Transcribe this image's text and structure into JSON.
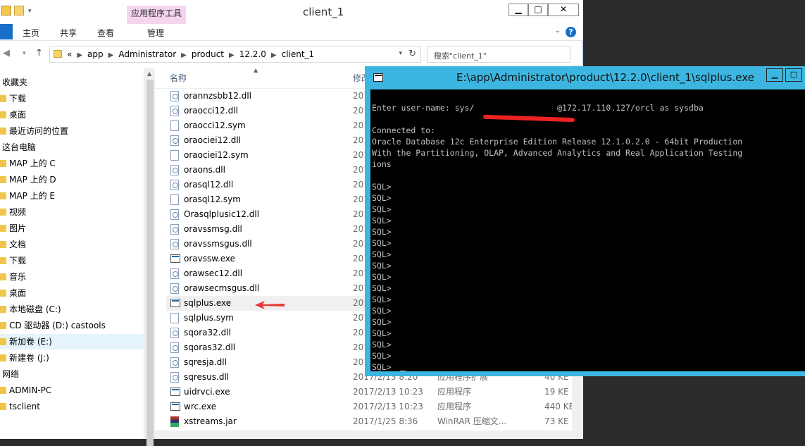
{
  "explorer": {
    "title": "client_1",
    "context_tab": "应用程序工具",
    "ribbon_tabs": [
      "主页",
      "共享",
      "查看",
      "管理"
    ],
    "help_glyph": "?",
    "address": [
      "app",
      "Administrator",
      "product",
      "12.2.0",
      "client_1"
    ],
    "address_prefix": "«",
    "search_placeholder": "搜索\"client_1\"",
    "nav_items": [
      {
        "label": "收藏夹",
        "kind": "header"
      },
      {
        "label": "下载",
        "kind": "item"
      },
      {
        "label": "桌面",
        "kind": "item"
      },
      {
        "label": "最近访问的位置",
        "kind": "item"
      },
      {
        "label": "这台电脑",
        "kind": "header"
      },
      {
        "label": "MAP 上的 C",
        "kind": "item"
      },
      {
        "label": "MAP 上的 D",
        "kind": "item"
      },
      {
        "label": "MAP 上的 E",
        "kind": "item"
      },
      {
        "label": "视频",
        "kind": "item"
      },
      {
        "label": "图片",
        "kind": "item"
      },
      {
        "label": "文档",
        "kind": "item"
      },
      {
        "label": "下载",
        "kind": "item"
      },
      {
        "label": "音乐",
        "kind": "item"
      },
      {
        "label": "桌面",
        "kind": "item"
      },
      {
        "label": "本地磁盘 (C:)",
        "kind": "item"
      },
      {
        "label": "CD 驱动器 (D:) castools",
        "kind": "item"
      },
      {
        "label": "新加卷 (E:)",
        "kind": "item",
        "selected": true
      },
      {
        "label": "新建卷 (J:)",
        "kind": "item"
      },
      {
        "label": "网络",
        "kind": "header"
      },
      {
        "label": "ADMIN-PC",
        "kind": "item"
      },
      {
        "label": "tsclient",
        "kind": "item"
      }
    ],
    "columns": {
      "name": "名称",
      "modified": "修改"
    },
    "files": [
      {
        "name": "orannzsbb12.dll",
        "kind": "dll",
        "date": "201",
        "type": "",
        "size": ""
      },
      {
        "name": "oraocci12.dll",
        "kind": "dll",
        "date": "201",
        "type": "",
        "size": ""
      },
      {
        "name": "oraocci12.sym",
        "kind": "sym",
        "date": "201",
        "type": "",
        "size": ""
      },
      {
        "name": "oraociei12.dll",
        "kind": "dll",
        "date": "201",
        "type": "",
        "size": ""
      },
      {
        "name": "oraociei12.sym",
        "kind": "sym",
        "date": "201",
        "type": "",
        "size": ""
      },
      {
        "name": "oraons.dll",
        "kind": "dll",
        "date": "201",
        "type": "",
        "size": ""
      },
      {
        "name": "orasql12.dll",
        "kind": "dll",
        "date": "201",
        "type": "",
        "size": ""
      },
      {
        "name": "orasql12.sym",
        "kind": "sym",
        "date": "201",
        "type": "",
        "size": ""
      },
      {
        "name": "Orasqlplusic12.dll",
        "kind": "dll",
        "date": "201",
        "type": "",
        "size": ""
      },
      {
        "name": "oravssmsg.dll",
        "kind": "dll",
        "date": "201",
        "type": "",
        "size": ""
      },
      {
        "name": "oravssmsgus.dll",
        "kind": "dll",
        "date": "201",
        "type": "",
        "size": ""
      },
      {
        "name": "oravssw.exe",
        "kind": "exe",
        "date": "201",
        "type": "",
        "size": ""
      },
      {
        "name": "orawsec12.dll",
        "kind": "dll",
        "date": "201",
        "type": "",
        "size": ""
      },
      {
        "name": "orawsecmsgus.dll",
        "kind": "dll",
        "date": "201",
        "type": "",
        "size": ""
      },
      {
        "name": "sqlplus.exe",
        "kind": "exe",
        "date": "201",
        "type": "",
        "size": "",
        "highlight": true
      },
      {
        "name": "sqlplus.sym",
        "kind": "sym",
        "date": "201",
        "type": "",
        "size": ""
      },
      {
        "name": "sqora32.dll",
        "kind": "dll",
        "date": "201",
        "type": "",
        "size": ""
      },
      {
        "name": "sqoras32.dll",
        "kind": "dll",
        "date": "201",
        "type": "",
        "size": ""
      },
      {
        "name": "sqresja.dll",
        "kind": "dll",
        "date": "201",
        "type": "",
        "size": ""
      },
      {
        "name": "sqresus.dll",
        "kind": "dll",
        "date": "2017/2/13 8:20",
        "type": "应用程序扩展",
        "size": "40 KE"
      },
      {
        "name": "uidrvci.exe",
        "kind": "exe",
        "date": "2017/2/13 10:23",
        "type": "应用程序",
        "size": "19 KE"
      },
      {
        "name": "wrc.exe",
        "kind": "exe",
        "date": "2017/2/13 10:23",
        "type": "应用程序",
        "size": "440 KE"
      },
      {
        "name": "xstreams.jar",
        "kind": "jar",
        "date": "2017/1/25 8:36",
        "type": "WinRAR 压缩文...",
        "size": "73 KE"
      }
    ]
  },
  "console": {
    "title": "E:\\app\\Administrator\\product\\12.2.0\\client_1\\sqlplus.exe",
    "lines": [
      "",
      "Enter user-name: sys/                 @172.17.110.127/orcl as sysdba",
      "",
      "Connected to:",
      "Oracle Database 12c Enterprise Edition Release 12.1.0.2.0 - 64bit Production",
      "With the Partitioning, OLAP, Advanced Analytics and Real Application Testing",
      "ions",
      "",
      "SQL>",
      "SQL>",
      "SQL>",
      "SQL>",
      "SQL>",
      "SQL>",
      "SQL>",
      "SQL>",
      "SQL>",
      "SQL>",
      "SQL>",
      "SQL>",
      "SQL>",
      "SQL>",
      "SQL>",
      "SQL>",
      "SQL>"
    ]
  },
  "colors": {
    "console_accent": "#3cb6e0",
    "selection": "#e5f3fb",
    "file_tab": "#1a6fc9",
    "annotation_arrow": "#e53935"
  }
}
